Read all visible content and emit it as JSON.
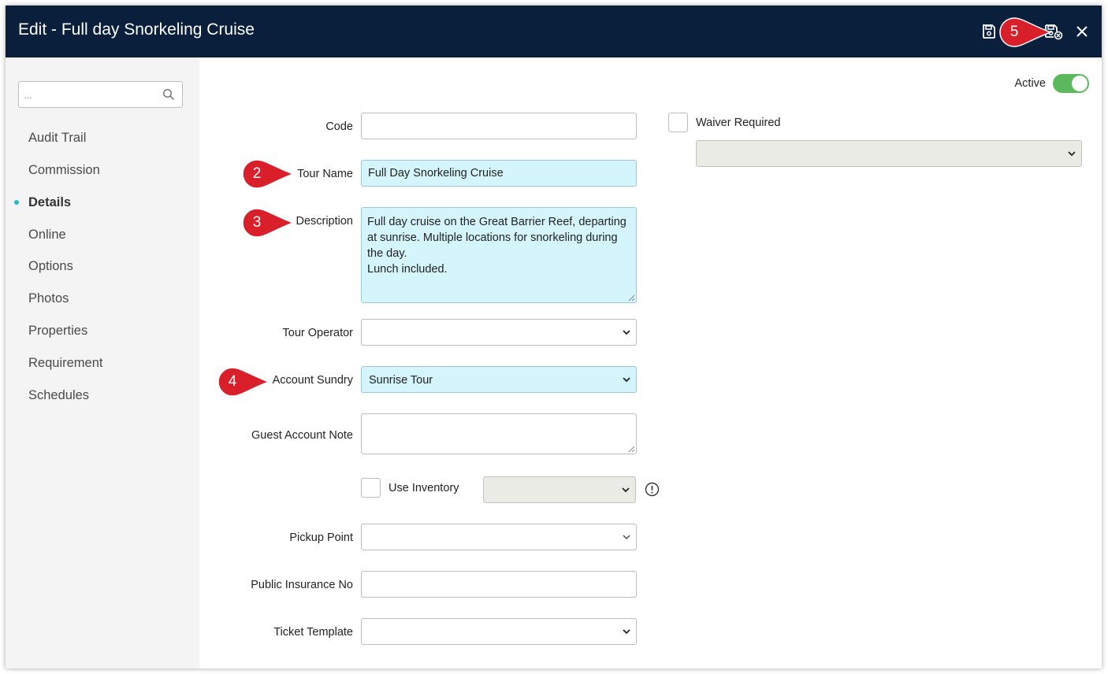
{
  "window": {
    "title": "Edit - Full day Snorkeling Cruise",
    "toolbar": {
      "save_icon": "save-icon",
      "save_close_icon": "save-close-icon",
      "close_icon": "close-icon"
    }
  },
  "sidebar": {
    "search_placeholder": "...",
    "items": [
      {
        "label": "Audit Trail"
      },
      {
        "label": "Commission"
      },
      {
        "label": "Details",
        "active": true
      },
      {
        "label": "Online"
      },
      {
        "label": "Options"
      },
      {
        "label": "Photos"
      },
      {
        "label": "Properties"
      },
      {
        "label": "Requirement"
      },
      {
        "label": "Schedules"
      }
    ]
  },
  "form": {
    "active_label": "Active",
    "active": true,
    "code": {
      "label": "Code",
      "value": ""
    },
    "tour_name": {
      "label": "Tour Name",
      "value": "Full Day Snorkeling Cruise"
    },
    "description": {
      "label": "Description",
      "value": "Full day cruise on the Great Barrier Reef, departing at sunrise. Multiple locations for snorkeling during the day.\nLunch included."
    },
    "tour_operator": {
      "label": "Tour Operator",
      "value": ""
    },
    "account_sundry": {
      "label": "Account Sundry",
      "value": "Sunrise Tour"
    },
    "guest_account_note": {
      "label": "Guest Account Note",
      "value": ""
    },
    "use_inventory": {
      "label": "Use Inventory",
      "checked": false
    },
    "pickup_point": {
      "label": "Pickup Point",
      "value": ""
    },
    "public_insurance_no": {
      "label": "Public Insurance No",
      "value": ""
    },
    "ticket_template": {
      "label": "Ticket Template",
      "value": ""
    },
    "waiver_required": {
      "label": "Waiver Required",
      "checked": false
    }
  },
  "annotations": {
    "m2": "2",
    "m3": "3",
    "m4": "4",
    "m5": "5"
  },
  "colors": {
    "titlebar": "#0a1f3b",
    "highlight": "#d4f5fb",
    "toggle": "#5cb85c",
    "marker": "#d81f2a",
    "active_dot": "#29b8c8"
  }
}
